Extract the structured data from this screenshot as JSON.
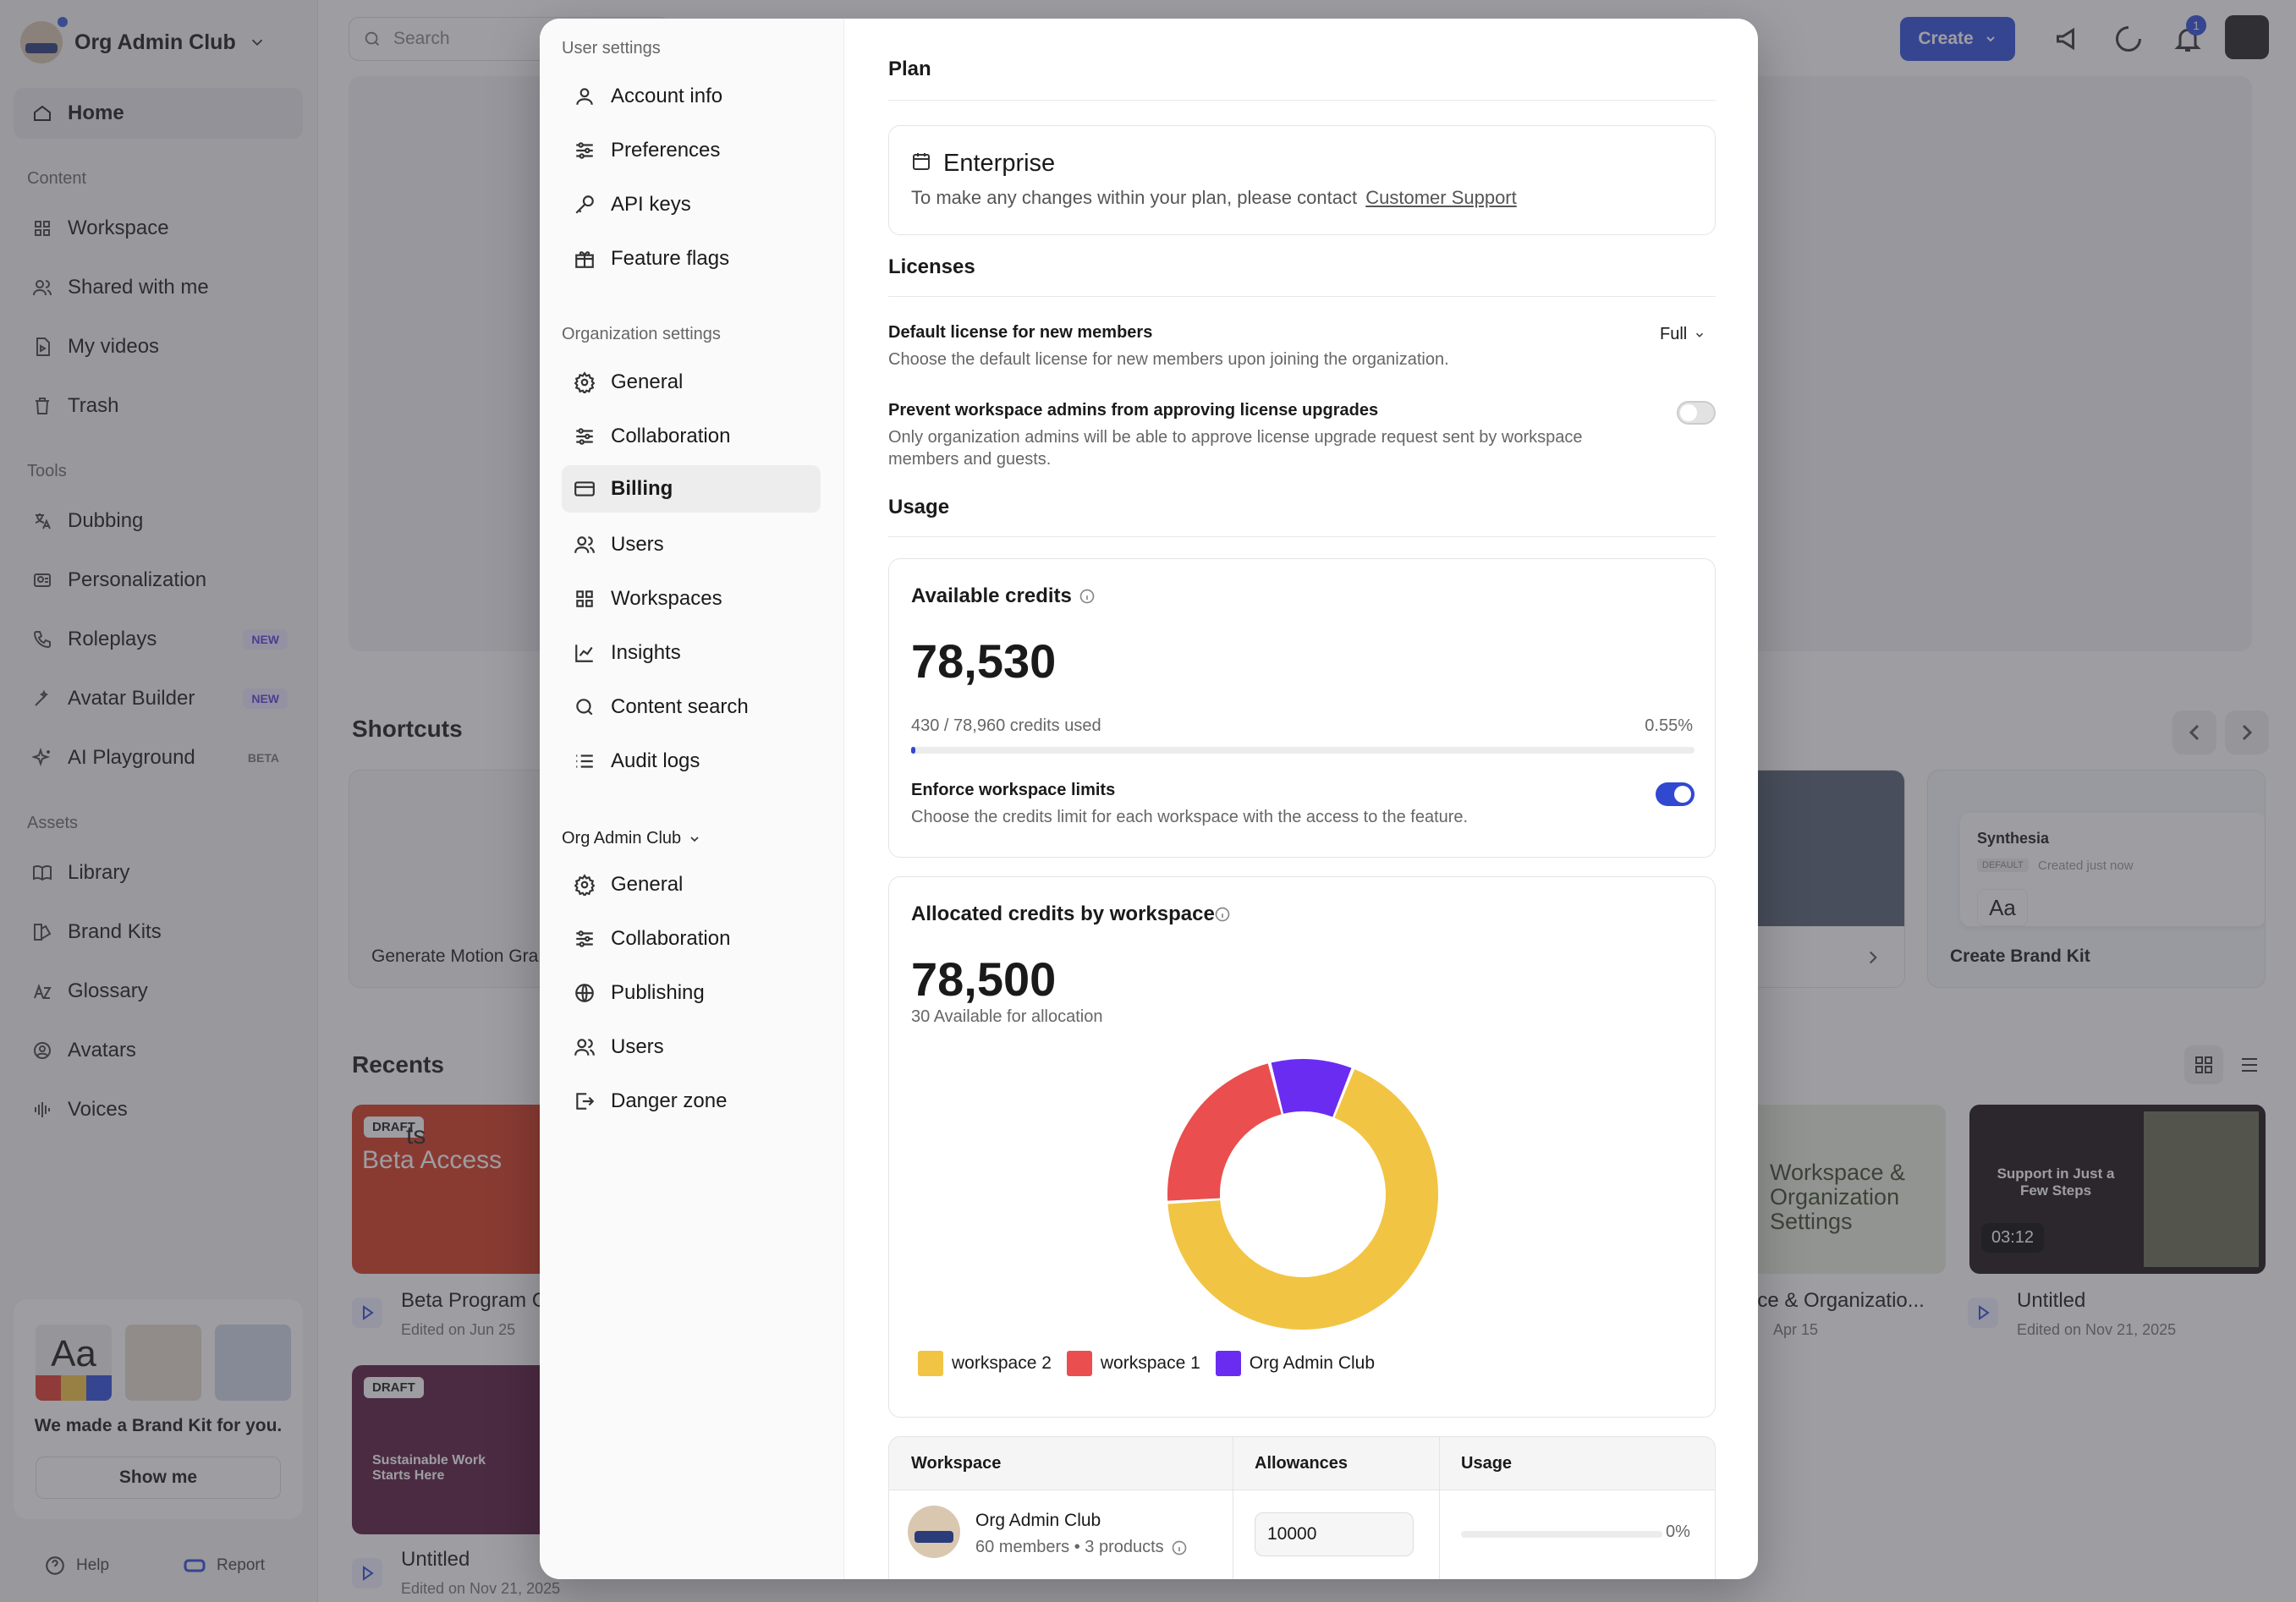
{
  "sidebar": {
    "org_name": "Org Admin Club",
    "nav_home": "Home",
    "sec_content": "Content",
    "content_items": [
      "Workspace",
      "Shared with me",
      "My videos",
      "Trash"
    ],
    "sec_tools": "Tools",
    "tools_items": [
      "Dubbing",
      "Personalization",
      "Roleplays",
      "Avatar Builder",
      "AI Playground"
    ],
    "badges": {
      "roleplays": "NEW",
      "avatar_builder": "NEW",
      "ai_playground": "BETA"
    },
    "sec_assets": "Assets",
    "asset_items": [
      "Library",
      "Brand Kits",
      "Glossary",
      "Avatars",
      "Voices"
    ],
    "brandkit": {
      "aa": "Aa",
      "text": "We made a Brand Kit for you.",
      "button": "Show me"
    },
    "help": "Help",
    "report": "Report"
  },
  "topbar": {
    "search_placeholder": "Search",
    "create": "Create",
    "notif_count": "1"
  },
  "background": {
    "shortcuts_title": "Shortcuts",
    "shortcut_card_1": "Generate Motion Gra",
    "shortcut_card_brand": "Create Brand Kit",
    "brand_preview": {
      "name": "Synthesia",
      "tag": "DEFAULT",
      "created": "Created just now",
      "aa": "Aa"
    },
    "recents_title": "Recents",
    "recents": [
      {
        "draft": "DRAFT",
        "thumb_text": "Beta Access",
        "thumb_prefix": "ts",
        "title": "Beta Program C",
        "sub": "Edited on Jun 25"
      },
      {
        "draft": "DRAFT",
        "thumb_text": "Sustainable Work Starts Here",
        "title": "Untitled",
        "sub": "Edited on Nov 21, 2025"
      },
      {
        "thumb_text": "Workspace & Organization Settings",
        "title": "ace & Organizatio...",
        "sub": "Apr 15"
      },
      {
        "thumb_text": "Support in Just a Few Steps",
        "duration": "03:12",
        "title": "Untitled",
        "sub": "Edited on Nov 21, 2025"
      }
    ]
  },
  "modal": {
    "sec_user": "User settings",
    "user_items": [
      "Account info",
      "Preferences",
      "API keys",
      "Feature flags"
    ],
    "sec_org": "Organization settings",
    "org_items": [
      "General",
      "Collaboration",
      "Billing",
      "Users",
      "Workspaces",
      "Insights",
      "Content search",
      "Audit logs"
    ],
    "sec_ws": "Org Admin Club",
    "ws_items": [
      "General",
      "Collaboration",
      "Publishing",
      "Users",
      "Danger zone"
    ],
    "plan_title": "Plan",
    "plan_name": "Enterprise",
    "plan_desc": "To make any changes within your plan, please contact",
    "plan_link": "Customer Support",
    "licenses_title": "Licenses",
    "default_license_label": "Default license for new members",
    "default_license_desc": "Choose the default license for new members upon joining the organization.",
    "default_license_value": "Full",
    "prevent_label": "Prevent workspace admins from approving license upgrades",
    "prevent_desc_1": "Only organization admins will be able to approve license upgrade request sent by workspace",
    "prevent_desc_2": "members and guests.",
    "usage_title": "Usage",
    "available_label": "Available credits",
    "available_value": "78,530",
    "credits_used": "430 / 78,960 credits used",
    "credits_pct": "0.55%",
    "credits_used_fraction": 0.0055,
    "enforce_label": "Enforce workspace limits",
    "enforce_desc": "Choose the credits limit for each workspace with the access to the feature.",
    "allocated_label": "Allocated credits by workspace",
    "allocated_value": "78,500",
    "allocated_sub": "30 Available for allocation",
    "table_headers": [
      "Workspace",
      "Allowances",
      "Usage"
    ],
    "row": {
      "name": "Org Admin Club",
      "meta": "60 members • 3 products",
      "allowance": "10000",
      "usage": "0%"
    }
  },
  "chart_data": {
    "type": "pie",
    "series": [
      {
        "name": "workspace 2",
        "value": 68,
        "color": "#f2c443"
      },
      {
        "name": "workspace 1",
        "value": 22,
        "color": "#ea4e4e"
      },
      {
        "name": "Org Admin Club",
        "value": 10,
        "color": "#6b2cf2"
      }
    ]
  }
}
